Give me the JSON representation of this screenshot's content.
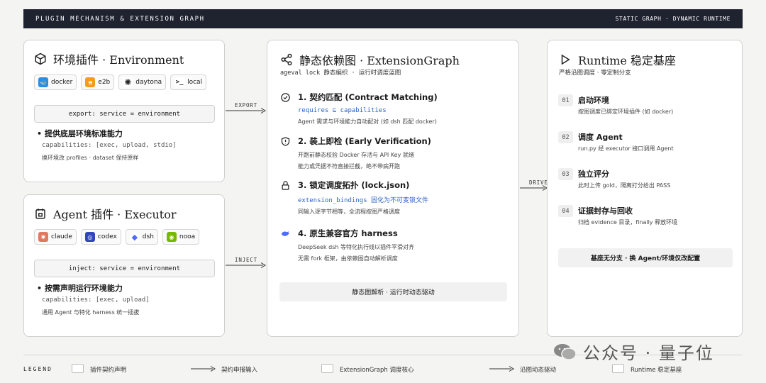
{
  "header": {
    "left": "PLUGIN MECHANISM & EXTENSION GRAPH",
    "right": "STATIC GRAPH · DYNAMIC RUNTIME"
  },
  "environment": {
    "title": "环境插件 · Environment",
    "chips": [
      "docker",
      "e2b",
      "daytona",
      "local"
    ],
    "code": "export: service = environment",
    "bullet": "• 提供底层环境标准能力",
    "capabilities": "capabilities: [exec, upload, stdio]",
    "note": "换环境改 profiles · dataset 保持原样"
  },
  "agent": {
    "title": "Agent 插件 · Executor",
    "chips": [
      "claude",
      "codex",
      "dsh",
      "nooa"
    ],
    "code": "inject: service = environment",
    "bullet": "• 按需声明运行环境能力",
    "capabilities": "capabilities: [exec, upload]",
    "note": "通用 Agent 与特化 harness 统一插拔"
  },
  "arrows": {
    "export": "EXPORT",
    "inject": "INJECT",
    "drive": "DRIVE"
  },
  "graph": {
    "title": "静态依赖图 · ExtensionGraph",
    "subtitle": "ageval lock 静态编织 · 运行时调度蓝图",
    "steps": [
      {
        "title": "1. 契约匹配 (Contract Matching)",
        "l1": "requires ⊆ capabilities",
        "l2": "Agent 需求与环境能力自动配对 (如 dsh 匹配 docker)"
      },
      {
        "title": "2. 装上即检 (Early Verification)",
        "l1": "开跑前静态校验 Docker 存活与 API Key 就绪",
        "l2": "能力或凭据不符直接拦截，绝不带病开跑"
      },
      {
        "title": "3. 锁定调度拓扑 (lock.json)",
        "l1": "extension_bindings 固化为不可变锁文件",
        "l2": "同输入逐字节相等，全流程按图严格调度"
      },
      {
        "title": "4. 原生兼容官方 harness",
        "l1": "DeepSeek dsh 等特化执行线以插件平滑对齐",
        "l2": "无需 fork 框架，由依赖图自动解析调度"
      }
    ],
    "footer": "静态图解析 · 运行时动态驱动"
  },
  "runtime": {
    "title": "Runtime 稳定基座",
    "subtitle": "严格沿图调度 · 零定制分支",
    "steps": [
      {
        "num": "01",
        "title": "启动环境",
        "desc": "按图调度已绑定环境插件 (如 docker)"
      },
      {
        "num": "02",
        "title": "调度 Agent",
        "desc": "run.py 经 executor 接口调用 Agent"
      },
      {
        "num": "03",
        "title": "独立评分",
        "desc": "此时上传 gold，隔离打分给出 PASS"
      },
      {
        "num": "04",
        "title": "证据封存与回收",
        "desc": "归档 evidence 目录，finally 释放环境"
      }
    ],
    "footer": "基座无分支 · 换 Agent/环境仅改配置"
  },
  "legend": {
    "title": "LEGEND",
    "items": [
      "插件契约声明",
      "契约申报输入",
      "ExtensionGraph 调度核心",
      "沿图动态驱动",
      "Runtime 稳定基座"
    ]
  },
  "watermark": "公众号 · 量子位"
}
